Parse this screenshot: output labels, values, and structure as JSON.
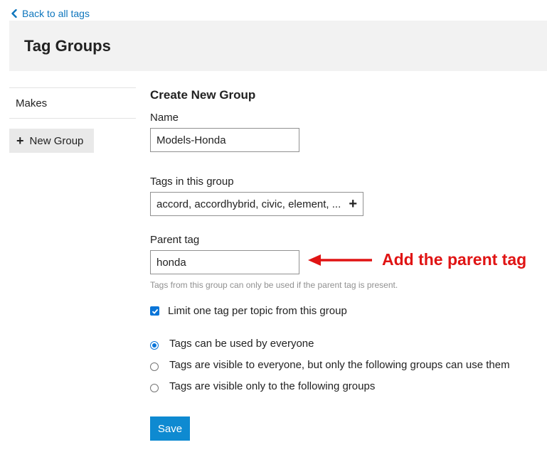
{
  "nav": {
    "back_label": "Back to all tags"
  },
  "header": {
    "title": "Tag Groups"
  },
  "sidebar": {
    "items": [
      {
        "label": "Makes"
      }
    ],
    "new_group_label": "New Group"
  },
  "form": {
    "section_title": "Create New Group",
    "name_label": "Name",
    "name_value": "Models-Honda",
    "tags_label": "Tags in this group",
    "tags_value": "accord, accordhybrid, civic, element, ...",
    "parent_label": "Parent tag",
    "parent_value": "honda",
    "parent_help": "Tags from this group can only be used if the parent tag is present.",
    "limit_label": "Limit one tag per topic from this group",
    "limit_checked": true,
    "visibility_options": [
      {
        "label": "Tags can be used by everyone",
        "selected": true
      },
      {
        "label": "Tags are visible to everyone, but only the following groups can use them",
        "selected": false
      },
      {
        "label": "Tags are visible only to the following groups",
        "selected": false
      }
    ],
    "save_label": "Save"
  },
  "annotation": {
    "text": "Add the parent tag",
    "color": "#e01414"
  },
  "colors": {
    "link": "#0e76bd",
    "primary_button": "#0e8ad1",
    "checkbox": "#0a75d8",
    "header_bg": "#f2f2f2"
  },
  "icons": {
    "back": "chevron-left-icon",
    "add": "plus-icon"
  }
}
